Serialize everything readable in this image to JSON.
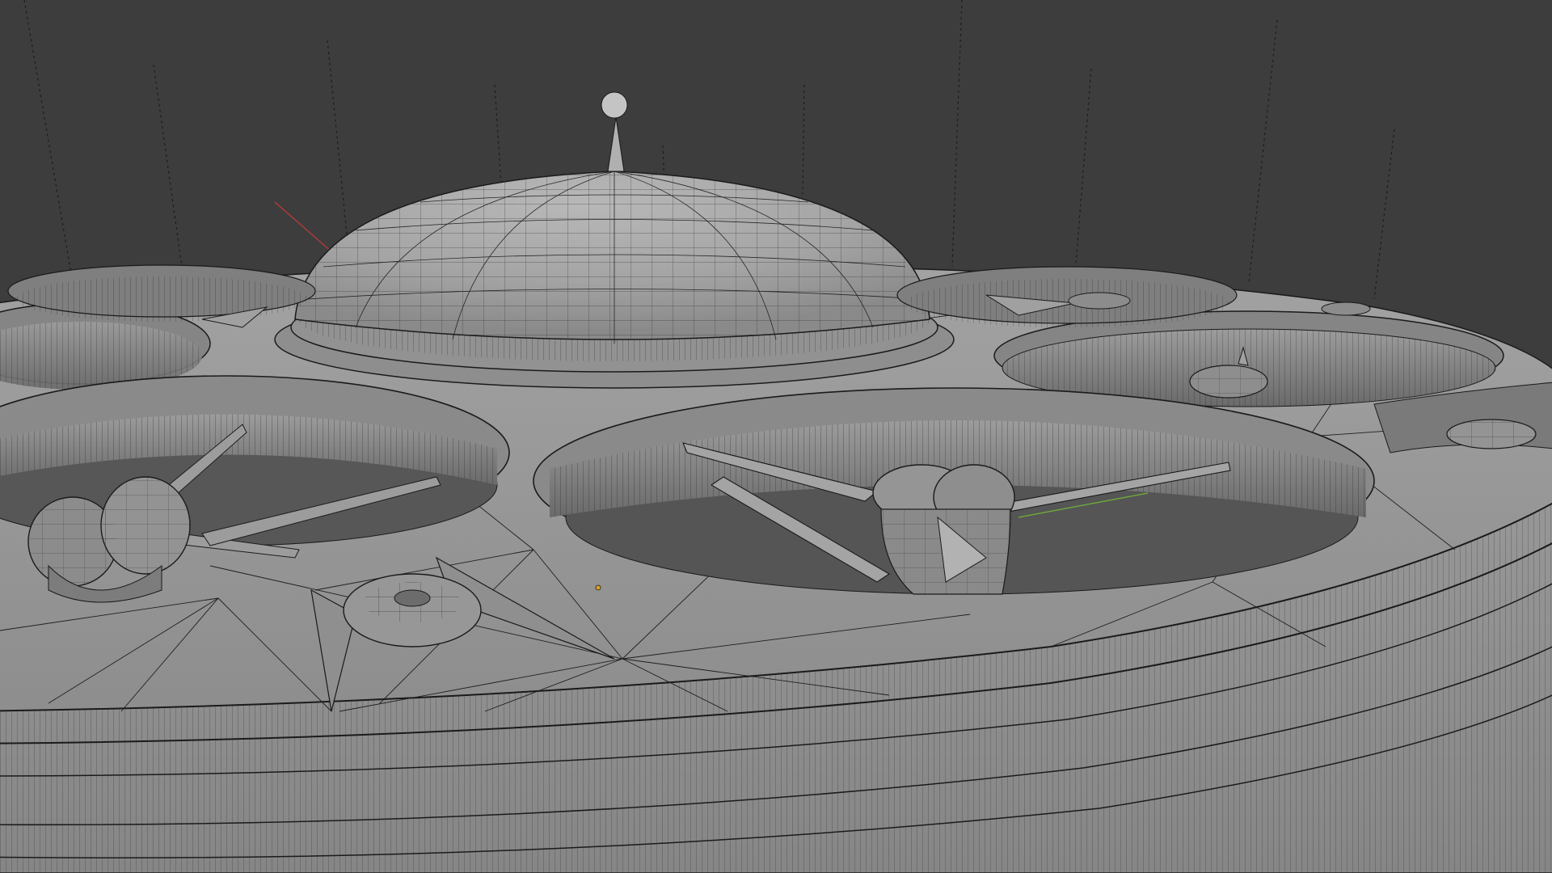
{
  "viewport": {
    "mode": "wireframe-overlay-solid",
    "background_color": "#3d3d3d",
    "grid_color": "#4a4a4a",
    "mesh_face_color": "#9a9a9a",
    "mesh_edge_color": "#1a1a1a",
    "axis_x_color": "#b53a3a",
    "axis_y_color": "#6ea83c",
    "origin_color": "#e0a020",
    "grid_visible": true
  },
  "scene": {
    "object": "saucer-drone-mesh",
    "parts": [
      "central-dome",
      "antenna",
      "antenna-ball",
      "outer-ring-hull",
      "rotor-duct",
      "rotor-blade",
      "motor-pod",
      "cone-spike"
    ]
  }
}
